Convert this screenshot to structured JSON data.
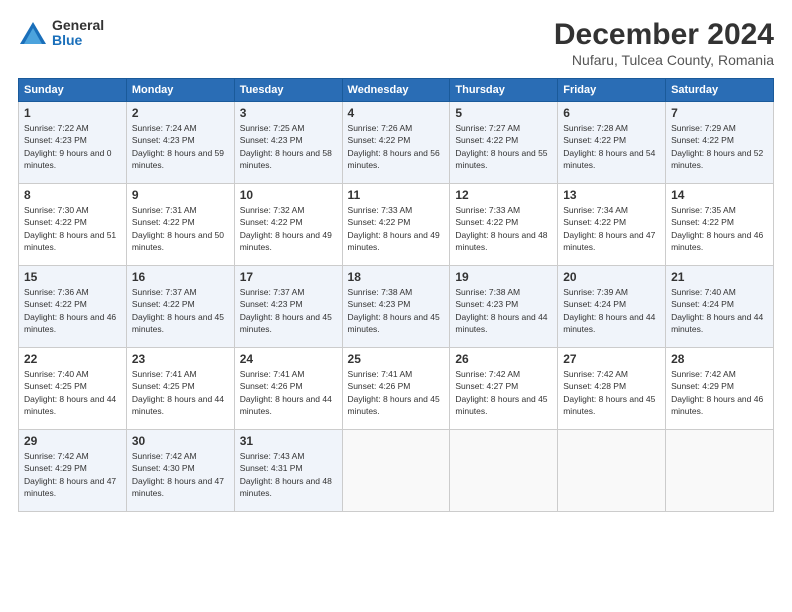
{
  "header": {
    "logo_general": "General",
    "logo_blue": "Blue",
    "month_title": "December 2024",
    "location": "Nufaru, Tulcea County, Romania"
  },
  "weekdays": [
    "Sunday",
    "Monday",
    "Tuesday",
    "Wednesday",
    "Thursday",
    "Friday",
    "Saturday"
  ],
  "weeks": [
    [
      {
        "day": "1",
        "sunrise": "Sunrise: 7:22 AM",
        "sunset": "Sunset: 4:23 PM",
        "daylight": "Daylight: 9 hours and 0 minutes."
      },
      {
        "day": "2",
        "sunrise": "Sunrise: 7:24 AM",
        "sunset": "Sunset: 4:23 PM",
        "daylight": "Daylight: 8 hours and 59 minutes."
      },
      {
        "day": "3",
        "sunrise": "Sunrise: 7:25 AM",
        "sunset": "Sunset: 4:23 PM",
        "daylight": "Daylight: 8 hours and 58 minutes."
      },
      {
        "day": "4",
        "sunrise": "Sunrise: 7:26 AM",
        "sunset": "Sunset: 4:22 PM",
        "daylight": "Daylight: 8 hours and 56 minutes."
      },
      {
        "day": "5",
        "sunrise": "Sunrise: 7:27 AM",
        "sunset": "Sunset: 4:22 PM",
        "daylight": "Daylight: 8 hours and 55 minutes."
      },
      {
        "day": "6",
        "sunrise": "Sunrise: 7:28 AM",
        "sunset": "Sunset: 4:22 PM",
        "daylight": "Daylight: 8 hours and 54 minutes."
      },
      {
        "day": "7",
        "sunrise": "Sunrise: 7:29 AM",
        "sunset": "Sunset: 4:22 PM",
        "daylight": "Daylight: 8 hours and 52 minutes."
      }
    ],
    [
      {
        "day": "8",
        "sunrise": "Sunrise: 7:30 AM",
        "sunset": "Sunset: 4:22 PM",
        "daylight": "Daylight: 8 hours and 51 minutes."
      },
      {
        "day": "9",
        "sunrise": "Sunrise: 7:31 AM",
        "sunset": "Sunset: 4:22 PM",
        "daylight": "Daylight: 8 hours and 50 minutes."
      },
      {
        "day": "10",
        "sunrise": "Sunrise: 7:32 AM",
        "sunset": "Sunset: 4:22 PM",
        "daylight": "Daylight: 8 hours and 49 minutes."
      },
      {
        "day": "11",
        "sunrise": "Sunrise: 7:33 AM",
        "sunset": "Sunset: 4:22 PM",
        "daylight": "Daylight: 8 hours and 49 minutes."
      },
      {
        "day": "12",
        "sunrise": "Sunrise: 7:33 AM",
        "sunset": "Sunset: 4:22 PM",
        "daylight": "Daylight: 8 hours and 48 minutes."
      },
      {
        "day": "13",
        "sunrise": "Sunrise: 7:34 AM",
        "sunset": "Sunset: 4:22 PM",
        "daylight": "Daylight: 8 hours and 47 minutes."
      },
      {
        "day": "14",
        "sunrise": "Sunrise: 7:35 AM",
        "sunset": "Sunset: 4:22 PM",
        "daylight": "Daylight: 8 hours and 46 minutes."
      }
    ],
    [
      {
        "day": "15",
        "sunrise": "Sunrise: 7:36 AM",
        "sunset": "Sunset: 4:22 PM",
        "daylight": "Daylight: 8 hours and 46 minutes."
      },
      {
        "day": "16",
        "sunrise": "Sunrise: 7:37 AM",
        "sunset": "Sunset: 4:22 PM",
        "daylight": "Daylight: 8 hours and 45 minutes."
      },
      {
        "day": "17",
        "sunrise": "Sunrise: 7:37 AM",
        "sunset": "Sunset: 4:23 PM",
        "daylight": "Daylight: 8 hours and 45 minutes."
      },
      {
        "day": "18",
        "sunrise": "Sunrise: 7:38 AM",
        "sunset": "Sunset: 4:23 PM",
        "daylight": "Daylight: 8 hours and 45 minutes."
      },
      {
        "day": "19",
        "sunrise": "Sunrise: 7:38 AM",
        "sunset": "Sunset: 4:23 PM",
        "daylight": "Daylight: 8 hours and 44 minutes."
      },
      {
        "day": "20",
        "sunrise": "Sunrise: 7:39 AM",
        "sunset": "Sunset: 4:24 PM",
        "daylight": "Daylight: 8 hours and 44 minutes."
      },
      {
        "day": "21",
        "sunrise": "Sunrise: 7:40 AM",
        "sunset": "Sunset: 4:24 PM",
        "daylight": "Daylight: 8 hours and 44 minutes."
      }
    ],
    [
      {
        "day": "22",
        "sunrise": "Sunrise: 7:40 AM",
        "sunset": "Sunset: 4:25 PM",
        "daylight": "Daylight: 8 hours and 44 minutes."
      },
      {
        "day": "23",
        "sunrise": "Sunrise: 7:41 AM",
        "sunset": "Sunset: 4:25 PM",
        "daylight": "Daylight: 8 hours and 44 minutes."
      },
      {
        "day": "24",
        "sunrise": "Sunrise: 7:41 AM",
        "sunset": "Sunset: 4:26 PM",
        "daylight": "Daylight: 8 hours and 44 minutes."
      },
      {
        "day": "25",
        "sunrise": "Sunrise: 7:41 AM",
        "sunset": "Sunset: 4:26 PM",
        "daylight": "Daylight: 8 hours and 45 minutes."
      },
      {
        "day": "26",
        "sunrise": "Sunrise: 7:42 AM",
        "sunset": "Sunset: 4:27 PM",
        "daylight": "Daylight: 8 hours and 45 minutes."
      },
      {
        "day": "27",
        "sunrise": "Sunrise: 7:42 AM",
        "sunset": "Sunset: 4:28 PM",
        "daylight": "Daylight: 8 hours and 45 minutes."
      },
      {
        "day": "28",
        "sunrise": "Sunrise: 7:42 AM",
        "sunset": "Sunset: 4:29 PM",
        "daylight": "Daylight: 8 hours and 46 minutes."
      }
    ],
    [
      {
        "day": "29",
        "sunrise": "Sunrise: 7:42 AM",
        "sunset": "Sunset: 4:29 PM",
        "daylight": "Daylight: 8 hours and 47 minutes."
      },
      {
        "day": "30",
        "sunrise": "Sunrise: 7:42 AM",
        "sunset": "Sunset: 4:30 PM",
        "daylight": "Daylight: 8 hours and 47 minutes."
      },
      {
        "day": "31",
        "sunrise": "Sunrise: 7:43 AM",
        "sunset": "Sunset: 4:31 PM",
        "daylight": "Daylight: 8 hours and 48 minutes."
      },
      null,
      null,
      null,
      null
    ]
  ]
}
